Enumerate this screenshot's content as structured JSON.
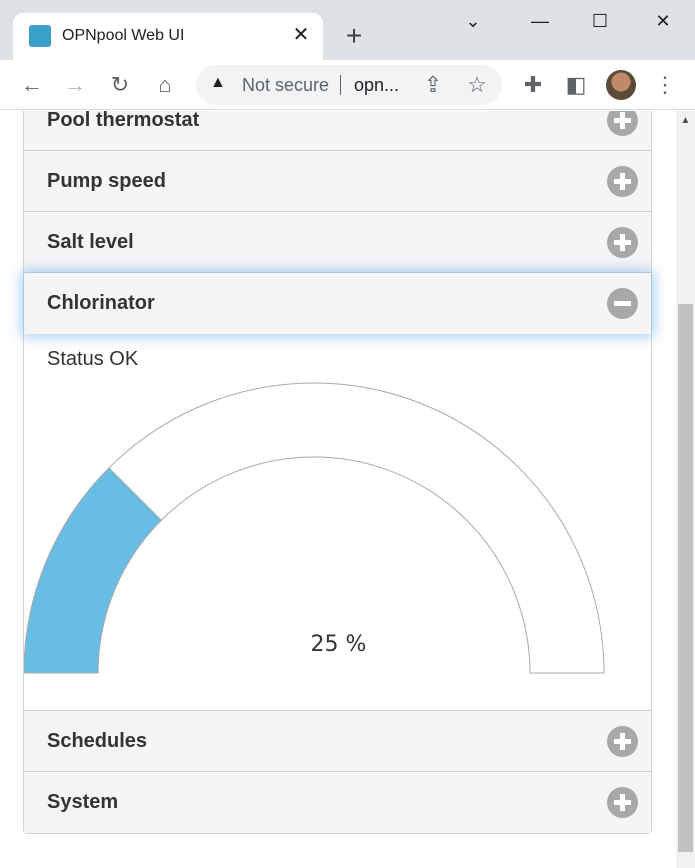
{
  "browser": {
    "tab_title": "OPNpool Web UI",
    "tab_close": "✕",
    "new_tab": "+",
    "omnibox_security": "Not secure",
    "omnibox_url": "opn..."
  },
  "accordion": {
    "items_above": [
      {
        "label": "Pool thermostat"
      },
      {
        "label": "Pump speed"
      },
      {
        "label": "Salt level"
      }
    ],
    "active": {
      "label": "Chlorinator",
      "status": "Status OK",
      "gauge_value": 25,
      "gauge_text": "25 %",
      "gauge_color": "#67bde4"
    },
    "items_below": [
      {
        "label": "Schedules"
      },
      {
        "label": "System"
      }
    ]
  }
}
